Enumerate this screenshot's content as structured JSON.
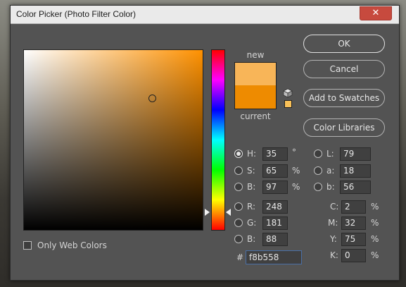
{
  "window": {
    "title": "Color Picker (Photo Filter Color)",
    "close_glyph": "✕"
  },
  "preview": {
    "new_label": "new",
    "current_label": "current",
    "new_color": "#f8b558",
    "current_color": "#ee8b00"
  },
  "buttons": {
    "ok": "OK",
    "cancel": "Cancel",
    "add_to_swatches": "Add to Swatches",
    "color_libraries": "Color Libraries"
  },
  "hsb": {
    "h": {
      "label": "H:",
      "value": "35",
      "unit": "°",
      "selected": true
    },
    "s": {
      "label": "S:",
      "value": "65",
      "unit": "%"
    },
    "b": {
      "label": "B:",
      "value": "97",
      "unit": "%"
    }
  },
  "rgb": {
    "r": {
      "label": "R:",
      "value": "248"
    },
    "g": {
      "label": "G:",
      "value": "181"
    },
    "b": {
      "label": "B:",
      "value": "88"
    }
  },
  "lab": {
    "l": {
      "label": "L:",
      "value": "79"
    },
    "a": {
      "label": "a:",
      "value": "18"
    },
    "b": {
      "label": "b:",
      "value": "56"
    }
  },
  "cmyk": {
    "c": {
      "label": "C:",
      "value": "2",
      "unit": "%"
    },
    "m": {
      "label": "M:",
      "value": "32",
      "unit": "%"
    },
    "y": {
      "label": "Y:",
      "value": "75",
      "unit": "%"
    },
    "k": {
      "label": "K:",
      "value": "0",
      "unit": "%"
    }
  },
  "hex": {
    "hash": "#",
    "value": "f8b558"
  },
  "options": {
    "only_web_colors": "Only Web Colors"
  },
  "colors": {
    "base_hue": "#ff9100",
    "picked": "#f8b558"
  },
  "icons": {
    "out_of_gamut": "cube-icon"
  }
}
